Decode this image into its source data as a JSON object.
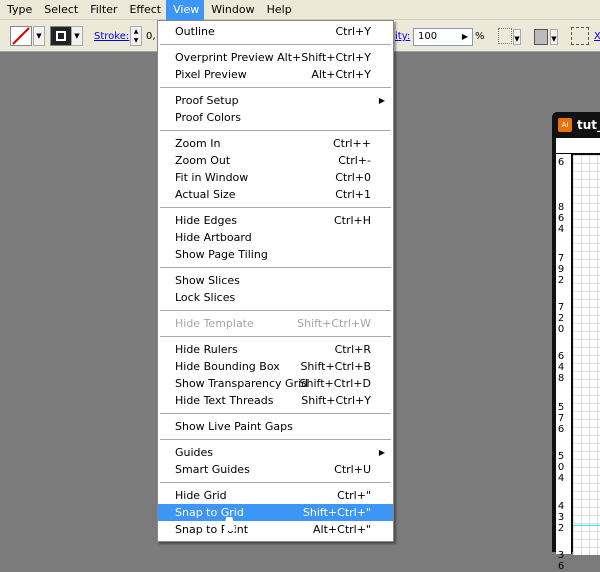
{
  "menubar": {
    "items": [
      "Type",
      "Select",
      "Filter",
      "Effect",
      "View",
      "Window",
      "Help"
    ],
    "active": "View"
  },
  "toolbar": {
    "stroke_label": "Stroke:",
    "stroke_value": "0,",
    "opacity_label": "ity:",
    "opacity_value": "100",
    "percent": "%",
    "x_label": "X"
  },
  "menu": {
    "items": [
      {
        "label": "Outline",
        "shortcut": "Ctrl+Y"
      },
      {
        "sep": true
      },
      {
        "label": "Overprint Preview",
        "shortcut": "Alt+Shift+Ctrl+Y"
      },
      {
        "label": "Pixel Preview",
        "shortcut": "Alt+Ctrl+Y"
      },
      {
        "sep": true
      },
      {
        "label": "Proof Setup",
        "shortcut": "",
        "submenu": true
      },
      {
        "label": "Proof Colors",
        "shortcut": ""
      },
      {
        "sep": true
      },
      {
        "label": "Zoom In",
        "shortcut": "Ctrl++"
      },
      {
        "label": "Zoom Out",
        "shortcut": "Ctrl+-"
      },
      {
        "label": "Fit in Window",
        "shortcut": "Ctrl+0"
      },
      {
        "label": "Actual Size",
        "shortcut": "Ctrl+1"
      },
      {
        "sep": true
      },
      {
        "label": "Hide Edges",
        "shortcut": "Ctrl+H"
      },
      {
        "label": "Hide Artboard",
        "shortcut": ""
      },
      {
        "label": "Show Page Tiling",
        "shortcut": ""
      },
      {
        "sep": true
      },
      {
        "label": "Show Slices",
        "shortcut": ""
      },
      {
        "label": "Lock Slices",
        "shortcut": ""
      },
      {
        "sep": true
      },
      {
        "label": "Hide Template",
        "shortcut": "Shift+Ctrl+W",
        "disabled": true
      },
      {
        "sep": true
      },
      {
        "label": "Hide Rulers",
        "shortcut": "Ctrl+R"
      },
      {
        "label": "Hide Bounding Box",
        "shortcut": "Shift+Ctrl+B"
      },
      {
        "label": "Show Transparency Grid",
        "shortcut": "Shift+Ctrl+D"
      },
      {
        "label": "Hide Text Threads",
        "shortcut": "Shift+Ctrl+Y"
      },
      {
        "sep": true
      },
      {
        "label": "Show Live Paint Gaps",
        "shortcut": ""
      },
      {
        "sep": true
      },
      {
        "label": "Guides",
        "shortcut": "",
        "submenu": true
      },
      {
        "label": "Smart Guides",
        "shortcut": "Ctrl+U"
      },
      {
        "sep": true
      },
      {
        "label": "Hide Grid",
        "shortcut": "Ctrl+\""
      },
      {
        "label": "Snap to Grid",
        "shortcut": "Shift+Ctrl+\"",
        "highlighted": true
      },
      {
        "label": "Snap to Point",
        "shortcut": "Alt+Ctrl+\""
      }
    ]
  },
  "document": {
    "title": "tut_",
    "icon": "AI",
    "ruler_labels": [
      "6",
      "8\n6\n4",
      "7\n9\n2",
      "7\n2\n0",
      "6\n4\n8",
      "5\n7\n6",
      "5\n0\n4",
      "4\n3\n2",
      "3\n6"
    ]
  },
  "colors": {
    "highlight": "#3d95f5",
    "canvas": "#7b7b7b"
  }
}
